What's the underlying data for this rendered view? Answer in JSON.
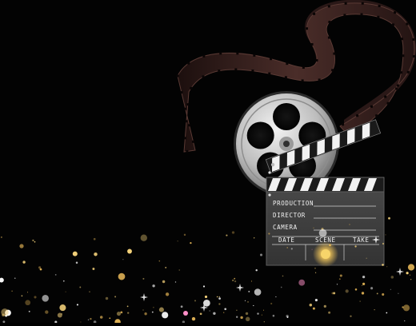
{
  "scene": {
    "background_color": "#030303",
    "film_strip_color": "#3a2422",
    "reel_color": "#c9c9c9",
    "clapboard_color": "#3d3d3d",
    "sparkle_colors": [
      "#f5d27a",
      "#ffffff",
      "#e0b255",
      "#ff8fc8"
    ]
  },
  "clapboard": {
    "rows": [
      {
        "label": "PRODUCTION"
      },
      {
        "label": "DIRECTOR"
      },
      {
        "label": "CAMERA"
      }
    ],
    "columns": [
      "DATE",
      "SCENE",
      "TAKE"
    ]
  },
  "icons": [
    "film-strip-icon",
    "film-reel-icon",
    "clapperboard-icon"
  ]
}
